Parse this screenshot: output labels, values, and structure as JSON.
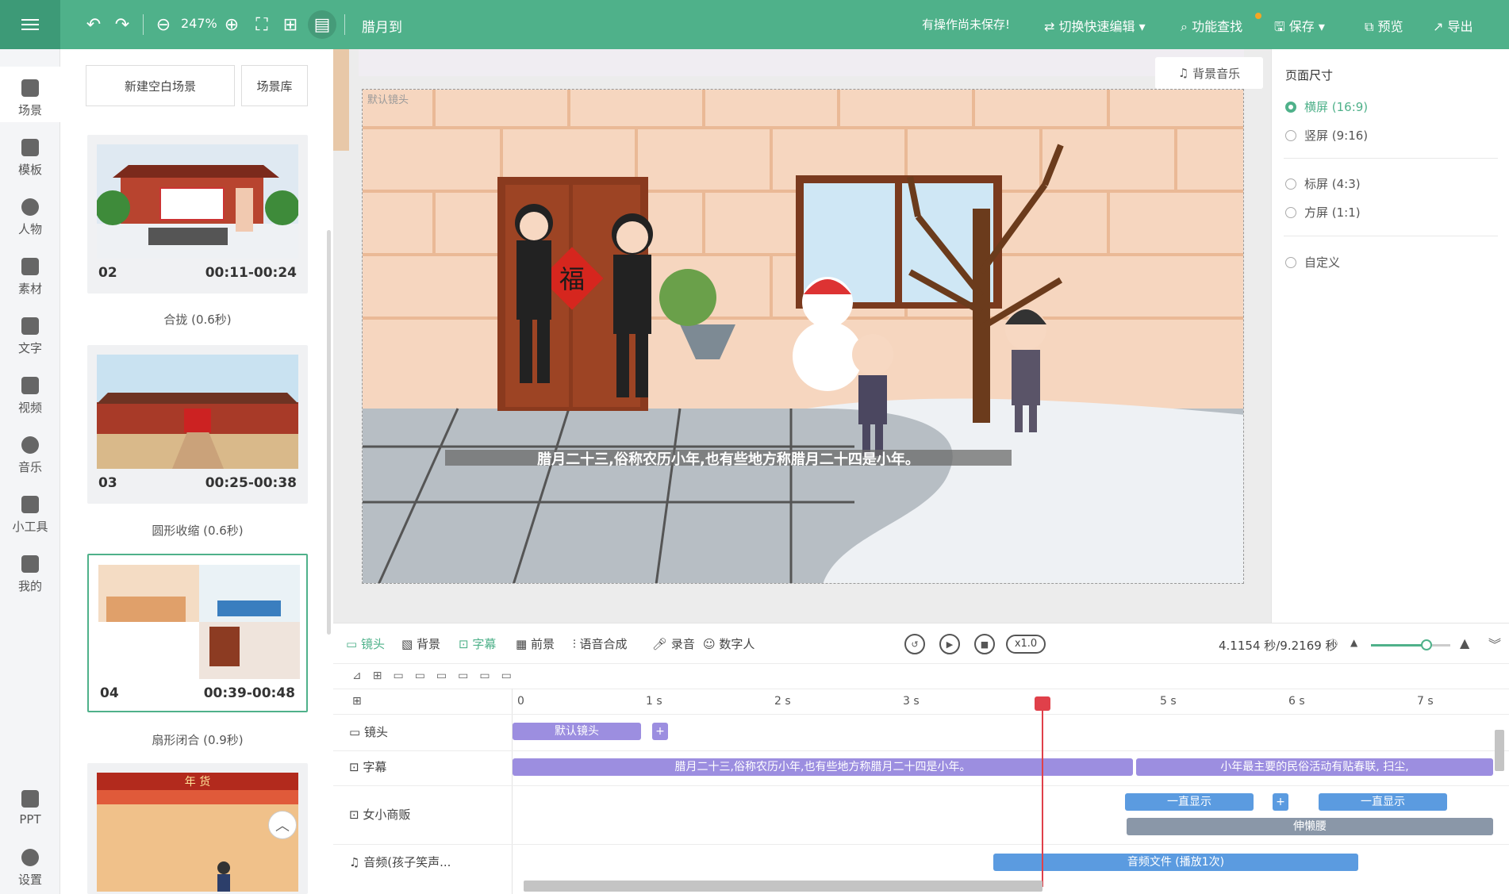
{
  "topbar": {
    "zoom": "247%",
    "title": "腊月到",
    "unsaved_notice": "有操作尚未保存!",
    "quick_edit": "切换快速编辑",
    "feature_search": "功能查找",
    "save": "保存",
    "preview": "预览",
    "export": "导出"
  },
  "nav": {
    "items": [
      {
        "label": "场景",
        "icon": "scene-icon"
      },
      {
        "label": "模板",
        "icon": "template-icon"
      },
      {
        "label": "人物",
        "icon": "person-icon"
      },
      {
        "label": "素材",
        "icon": "material-icon"
      },
      {
        "label": "文字",
        "icon": "text-icon"
      },
      {
        "label": "视频",
        "icon": "video-icon"
      },
      {
        "label": "音乐",
        "icon": "music-icon"
      },
      {
        "label": "小工具",
        "icon": "toolbox-icon"
      },
      {
        "label": "我的",
        "icon": "mine-icon"
      }
    ],
    "ppt": "PPT",
    "settings": "设置"
  },
  "scenes": {
    "new_blank": "新建空白场景",
    "library": "场景库",
    "cards": [
      {
        "num": "02",
        "time": "00:11-00:24",
        "transition": "合拢 (0.6秒)"
      },
      {
        "num": "03",
        "time": "00:25-00:38",
        "transition": "圆形收缩 (0.6秒)"
      },
      {
        "num": "04",
        "time": "00:39-00:48",
        "transition": "扇形闭合 (0.9秒)"
      }
    ],
    "card5_sign": "年 货"
  },
  "canvas": {
    "bg_music": "背景音乐",
    "default_shot": "默认镜头",
    "subtitle": "腊月二十三,俗称农历小年,也有些地方称腊月二十四是小年。",
    "fu": "福"
  },
  "page_size": {
    "title": "页面尺寸",
    "options": [
      {
        "label": "横屏 (16:9)",
        "selected": true
      },
      {
        "label": "竖屏 (9:16)",
        "selected": false
      },
      {
        "label": "标屏 (4:3)",
        "selected": false
      },
      {
        "label": "方屏 (1:1)",
        "selected": false
      },
      {
        "label": "自定义",
        "selected": false
      }
    ]
  },
  "timeline": {
    "tabs": [
      "镜头",
      "背景",
      "字幕",
      "前景",
      "语音合成",
      "录音",
      "数字人"
    ],
    "speed": "x1.0",
    "time_readout": "4.1154 秒/9.2169 秒",
    "ruler": [
      "0",
      "1 s",
      "2 s",
      "3 s",
      "5 s",
      "6 s",
      "7 s"
    ],
    "tracks": [
      {
        "label": "镜头"
      },
      {
        "label": "字幕"
      },
      {
        "label": "女小商贩"
      },
      {
        "label": "音频(孩子笑声..."
      }
    ],
    "bars": {
      "shot": "默认镜头",
      "sub1": "腊月二十三,俗称农历小年,也有些地方称腊月二十四是小年。",
      "sub2": "小年最主要的民俗活动有贴春联, 扫尘,",
      "show1": "一直显示",
      "show2": "一直显示",
      "stretch": "伸懒腰",
      "audio": "音频文件 (播放1次)"
    },
    "slider_value": 0.7
  },
  "colors": {
    "brand": "#4fb18a",
    "subtitle_bar": "#9c8ee0",
    "action_bar": "#5b9be0",
    "gray_bar": "#8a97a8"
  }
}
